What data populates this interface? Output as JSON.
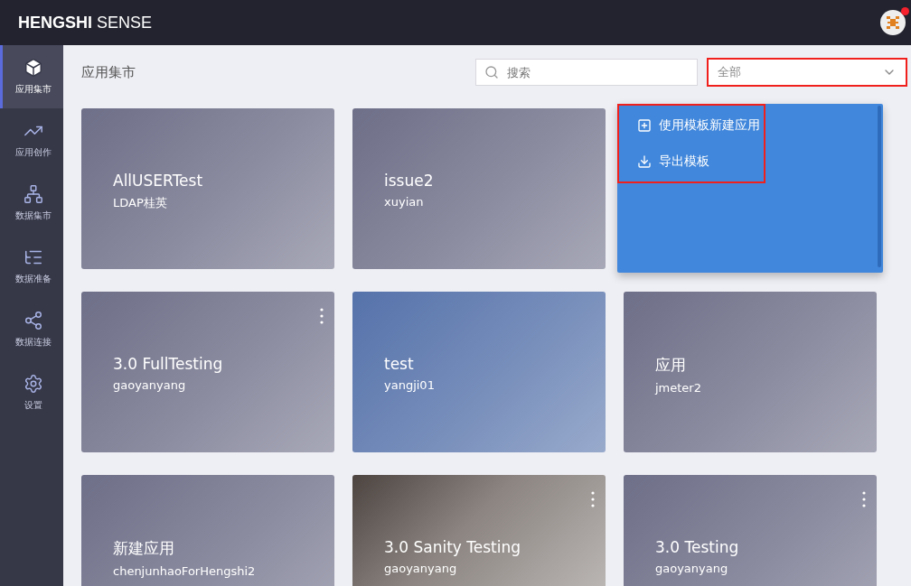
{
  "header": {
    "brand_bold": "HENGSHI",
    "brand_light": "SENSE",
    "notification": true
  },
  "sidebar": {
    "items": [
      {
        "label": "应用集市",
        "selected": true
      },
      {
        "label": "应用创作",
        "selected": false
      },
      {
        "label": "数据集市",
        "selected": false
      },
      {
        "label": "数据准备",
        "selected": false
      },
      {
        "label": "数据连接",
        "selected": false
      },
      {
        "label": "设置",
        "selected": false
      }
    ]
  },
  "page_title": "应用集市",
  "search": {
    "placeholder": "搜索"
  },
  "filter": {
    "value": "全部",
    "highlighted": true
  },
  "context_menu": {
    "highlighted": true,
    "items": [
      {
        "label": "使用模板新建应用"
      },
      {
        "label": "导出模板"
      }
    ]
  },
  "cards": [
    {
      "kind": "app",
      "title": "AllUSERTest",
      "owner": "LDAP桂英",
      "color": "#6e6f88",
      "more_button": false
    },
    {
      "kind": "app",
      "title": "issue2",
      "owner": "xuyian",
      "color": "#6e6f88",
      "more_button": false
    },
    {
      "kind": "app",
      "title": "3.0 FullTesting",
      "owner": "gaoyanyang",
      "color": "#6e6f88",
      "more_button": true
    },
    {
      "kind": "app",
      "title": "test",
      "owner": "yangji01",
      "color": "#5572aa",
      "more_button": false
    },
    {
      "kind": "app",
      "title": "应用",
      "owner": "jmeter2",
      "color": "#6e6f88",
      "more_button": false
    },
    {
      "kind": "app",
      "title": "新建应用",
      "owner": "chenjunhaoForHengshi2",
      "color": "#6e6f88",
      "more_button": false
    },
    {
      "kind": "photo",
      "title": "3.0 Sanity Testing",
      "owner": "gaoyanyang",
      "color": "#5a504b",
      "more_button": true
    },
    {
      "kind": "app",
      "title": "3.0 Testing",
      "owner": "gaoyanyang",
      "color": "#6e6f88",
      "more_button": true
    }
  ]
}
